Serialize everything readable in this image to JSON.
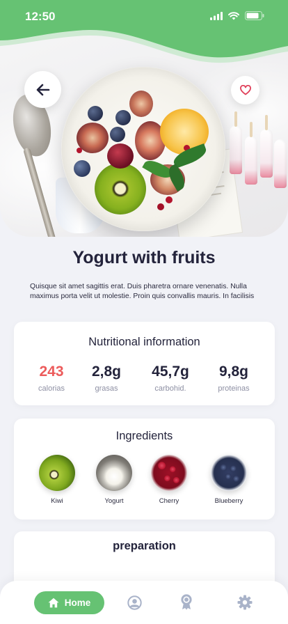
{
  "status_bar": {
    "time": "12:50"
  },
  "colors": {
    "brand_green": "#66c273",
    "accent_red": "#ec5b5b",
    "text_dark": "#23233b",
    "text_muted": "#8d8fa3",
    "background": "#f1f2f7"
  },
  "icons": {
    "back": "arrow-left-icon",
    "favorite": "heart-icon",
    "home": "home-icon",
    "profile": "user-icon",
    "awards": "award-icon",
    "settings": "gear-icon"
  },
  "recipe": {
    "title": "Yogurt with fruits",
    "description": "Quisque sit amet sagittis erat. Duis pharetra ornare venenatis. Nulla maximus porta velit ut molestie. Proin quis convallis mauris. In facilisis"
  },
  "nutrition": {
    "title": "Nutritional information",
    "stats": [
      {
        "value": "243",
        "label": "calorias"
      },
      {
        "value": "2,8g",
        "label": "grasas"
      },
      {
        "value": "45,7g",
        "label": "carbohid."
      },
      {
        "value": "9,8g",
        "label": "proteinas"
      }
    ]
  },
  "ingredients": {
    "title": "Ingredients",
    "items": [
      {
        "label": "Kiwi"
      },
      {
        "label": "Yogurt"
      },
      {
        "label": "Cherry"
      },
      {
        "label": "Blueberry"
      }
    ]
  },
  "preparation": {
    "title": "preparation"
  },
  "nav": {
    "home_label": "Home"
  }
}
